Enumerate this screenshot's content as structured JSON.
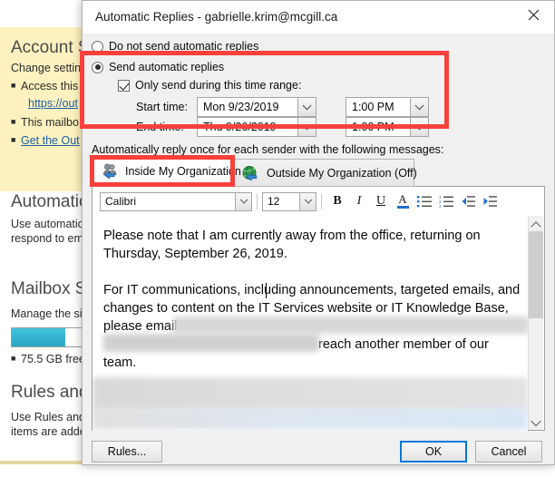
{
  "background": {
    "sections": [
      {
        "heading": "Account S",
        "paragraph": "Change settings",
        "bullets": [
          {
            "text": "Access this",
            "link": false
          },
          {
            "text": "https://out",
            "link": true
          },
          {
            "text": "This mailbo",
            "link": false
          },
          {
            "text": "Get the Out",
            "link": true
          }
        ]
      },
      {
        "heading": "Automatic",
        "lines": [
          "Use automatic r",
          "respond to ema"
        ]
      },
      {
        "heading": "Mailbox Se",
        "lines": [
          "Manage the size"
        ],
        "progress": {
          "percent": 70,
          "color": "#34b4d0"
        },
        "bullets": [
          {
            "text": "75.5 GB free",
            "link": false
          }
        ]
      },
      {
        "heading": "Rules and",
        "lines": [
          "Use Rules and A",
          "items are added"
        ]
      }
    ]
  },
  "dialog": {
    "title": "Automatic Replies - gabrielle.krim@mcgill.ca",
    "close_label": "Close",
    "options": {
      "do_not_send_label": "Do not send automatic replies",
      "do_not_send_checked": false,
      "send_label": "Send automatic replies",
      "send_checked": true,
      "time_range_label": "Only send during this time range:",
      "time_range_checked": true,
      "start_label": "Start time:",
      "start_date": "Mon 9/23/2019",
      "start_time": "1:00 PM",
      "end_label": "End time:",
      "end_date": "Thu 9/26/2019",
      "end_time": "1:00 PM"
    },
    "reply_note": "Automatically reply once for each sender with the following messages:",
    "tabs": [
      {
        "label": "Inside My Organization",
        "icon": "people-icon",
        "active": true
      },
      {
        "label": "Outside My Organization (Off)",
        "icon": "globe-icon",
        "active": false
      }
    ],
    "toolbar": {
      "font_family": "Calibri",
      "font_size": "12",
      "bold_label": "B",
      "italic_label": "I",
      "underline_label": "U",
      "font_color_label": "A",
      "font_color_accent": "#1f6fd0",
      "bullet_list_name": "bulleted-list",
      "numbered_list_name": "numbered-list",
      "decrease_indent_name": "decrease-indent",
      "increase_indent_name": "increase-indent"
    },
    "message": {
      "lines": [
        "Please note that I am currently away from the office, returning on",
        "Thursday, September 26, 2019.",
        "",
        "For IT communications, including announcements, targeted emails, and",
        "changes to content on the IT Services website or IT Knowledge Base,",
        "please email",
        "reach another member of our",
        "team."
      ]
    },
    "scrollbar": {
      "up": "scroll-up",
      "down": "scroll-down",
      "thumb": "scroll-thumb"
    },
    "buttons": {
      "rules_label": "Rules...",
      "ok_label": "OK",
      "cancel_label": "Cancel"
    }
  },
  "annotations": {
    "color": "#f8403c",
    "boxes": [
      "time-range-highlight",
      "inside-organization-tab-highlight"
    ]
  }
}
